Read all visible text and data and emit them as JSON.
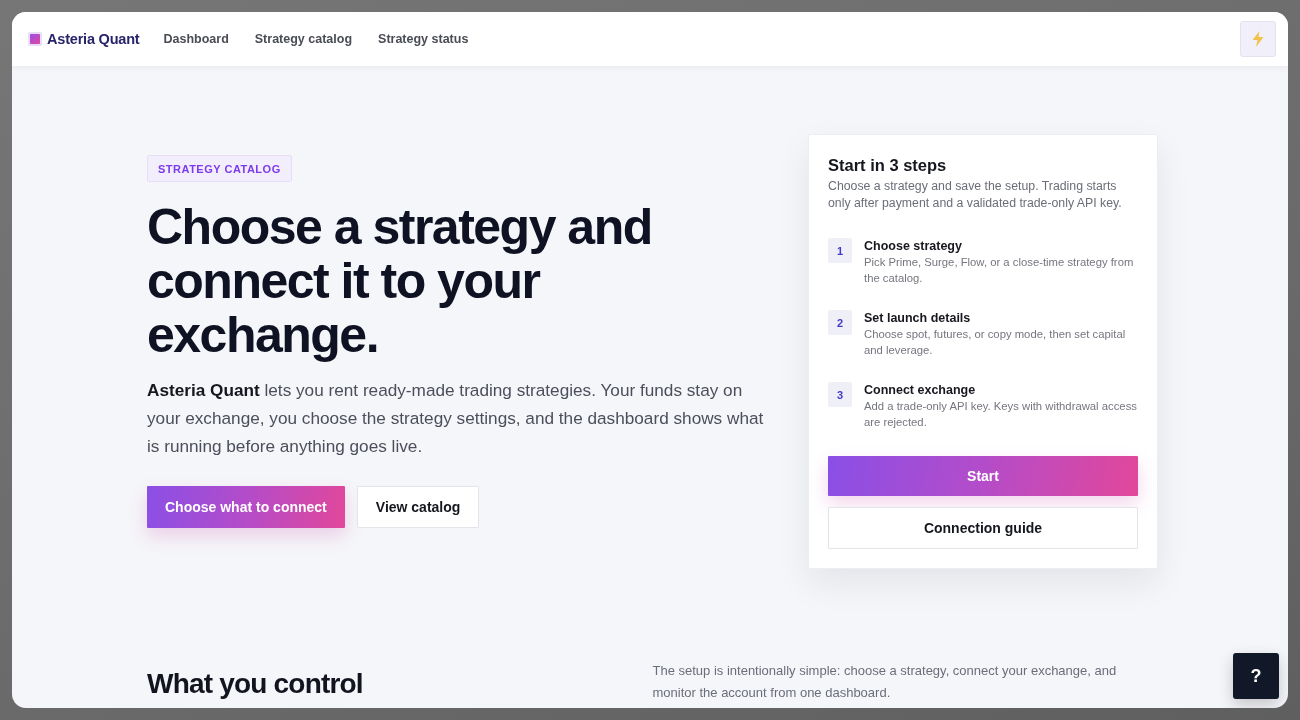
{
  "header": {
    "brand": "Asteria Quant",
    "nav": [
      {
        "label": "Dashboard"
      },
      {
        "label": "Strategy catalog"
      },
      {
        "label": "Strategy status"
      }
    ]
  },
  "hero": {
    "badge": "STRATEGY CATALOG",
    "title": "Choose a strategy and connect it to your exchange.",
    "intro": "**Asteria Quant** lets you rent ready-made trading strategies. Your funds stay on your exchange, you choose the strategy settings, and the dashboard shows what is running before anything goes live.",
    "buttons": [
      {
        "label": "Choose what to connect",
        "kind": "primary"
      },
      {
        "label": "View catalog",
        "kind": "secondary"
      }
    ]
  },
  "steps_card": {
    "title": "Start in 3 steps",
    "description": "Choose a strategy and save the setup. Trading starts only after payment and a validated trade-only API key.",
    "steps": [
      {
        "number": "1",
        "title": "Choose strategy",
        "description": "Pick Prime, Surge, Flow, or a close-time strategy from the catalog."
      },
      {
        "number": "2",
        "title": "Set launch details",
        "description": "Choose spot, futures, or copy mode, then set capital and leverage."
      },
      {
        "number": "3",
        "title": "Connect exchange",
        "description": "Add a trade-only API key. Keys with withdrawal access are rejected."
      }
    ],
    "buttons": [
      {
        "label": "Start",
        "kind": "primary"
      },
      {
        "label": "Connection guide",
        "kind": "secondary"
      }
    ]
  },
  "control_section": {
    "title": "What you control",
    "description": "The setup is intentionally simple: choose a strategy, connect your exchange, and monitor the account from one dashboard."
  },
  "help_button": {
    "label": "?"
  }
}
